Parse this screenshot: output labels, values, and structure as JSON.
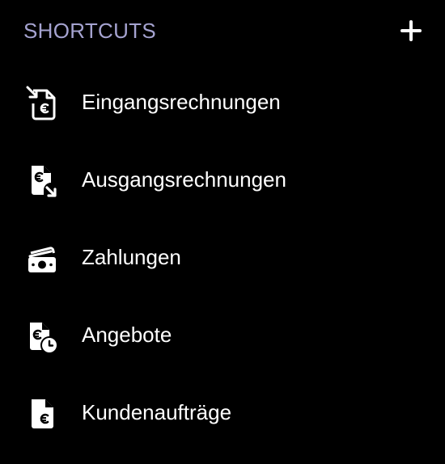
{
  "shortcuts": {
    "title": "SHORTCUTS",
    "title_color": "#a5a3d0",
    "add_icon": "plus-icon",
    "items": [
      {
        "label": "Eingangsrechnungen",
        "icon": "incoming-invoice-icon"
      },
      {
        "label": "Ausgangsrechnungen",
        "icon": "outgoing-invoice-icon"
      },
      {
        "label": "Zahlungen",
        "icon": "payments-cash-icon"
      },
      {
        "label": "Angebote",
        "icon": "quote-clock-icon"
      },
      {
        "label": "Kundenaufträge",
        "icon": "customer-order-icon"
      }
    ]
  }
}
